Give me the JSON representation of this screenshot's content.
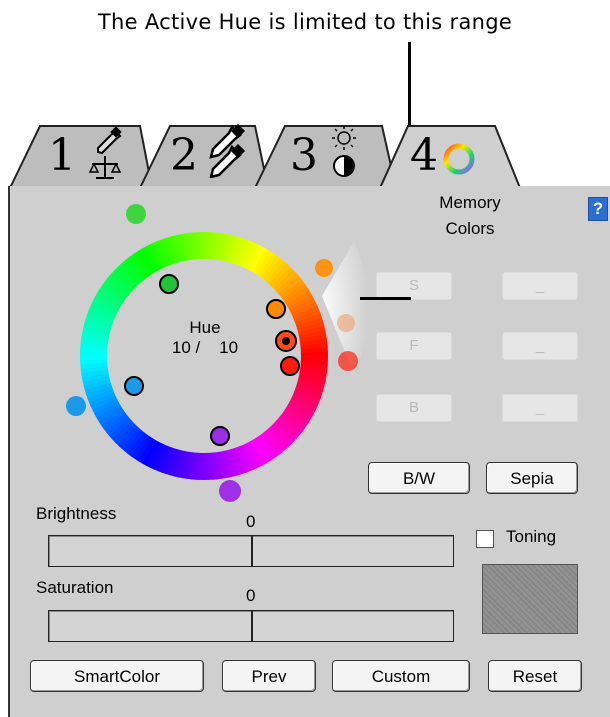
{
  "callout": {
    "text": "The Active Hue is limited to this range"
  },
  "tabs": [
    {
      "number": "1",
      "icon": "eyedropper-scale-icon"
    },
    {
      "number": "2",
      "icon": "double-eyedropper-icon"
    },
    {
      "number": "3",
      "icon": "brightness-contrast-icon"
    },
    {
      "number": "4",
      "icon": "color-ring-icon",
      "active": true
    }
  ],
  "memory_colors": {
    "title_line1": "Memory",
    "title_line2": "Colors",
    "help_glyph": "?",
    "buttons": [
      "S",
      "_",
      "F",
      "_",
      "B",
      "_"
    ]
  },
  "hue": {
    "label": "Hue",
    "current": "10 /",
    "total": "10"
  },
  "buttons": {
    "bw": "B/W",
    "sepia": "Sepia",
    "smartcolor": "SmartColor",
    "prev": "Prev",
    "custom": "Custom",
    "reset": "Reset"
  },
  "brightness": {
    "label": "Brightness",
    "value": "0"
  },
  "saturation": {
    "label": "Saturation",
    "value": "0"
  },
  "toning": {
    "label": "Toning",
    "checked": false
  }
}
